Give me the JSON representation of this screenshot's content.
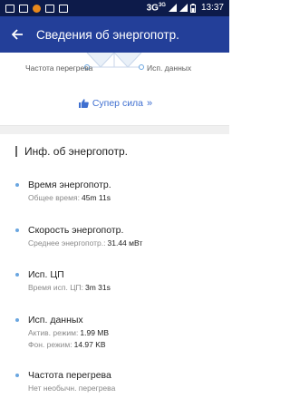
{
  "status_bar": {
    "network": "3G",
    "network_sup": "3G",
    "battery": "",
    "time": "13:37"
  },
  "app_bar": {
    "title": "Сведения об энергопотр."
  },
  "radar": {
    "label_left": "Частота перегрева",
    "label_right": "Исп. данных"
  },
  "super_power": {
    "label": "Супер сила",
    "chevron": "»"
  },
  "section": {
    "title": "Инф. об энергопотр."
  },
  "items": [
    {
      "title": "Время энергопотр.",
      "rows": [
        {
          "label": "Общее время:",
          "value": "45m 11s"
        }
      ]
    },
    {
      "title": "Скорость энергопотр.",
      "rows": [
        {
          "label": "Среднее энергопотр.:",
          "value": "31.44 мВт"
        }
      ]
    },
    {
      "title": "Исп. ЦП",
      "rows": [
        {
          "label": "Время исп. ЦП:",
          "value": "3m 31s"
        }
      ]
    },
    {
      "title": "Исп. данных",
      "rows": [
        {
          "label": "Актив. режим:",
          "value": "1.99 MB"
        },
        {
          "label": "Фон. режим:",
          "value": "14.97 KB"
        }
      ]
    },
    {
      "title": "Частота перегрева",
      "rows": [
        {
          "label": "Нет необычн. перегрева",
          "value": ""
        }
      ]
    }
  ],
  "colors": {
    "app_bar": "#233f99",
    "status_bar": "#0d1b4a",
    "accent": "#3f6fd0",
    "bullet": "#6aa6e0"
  }
}
